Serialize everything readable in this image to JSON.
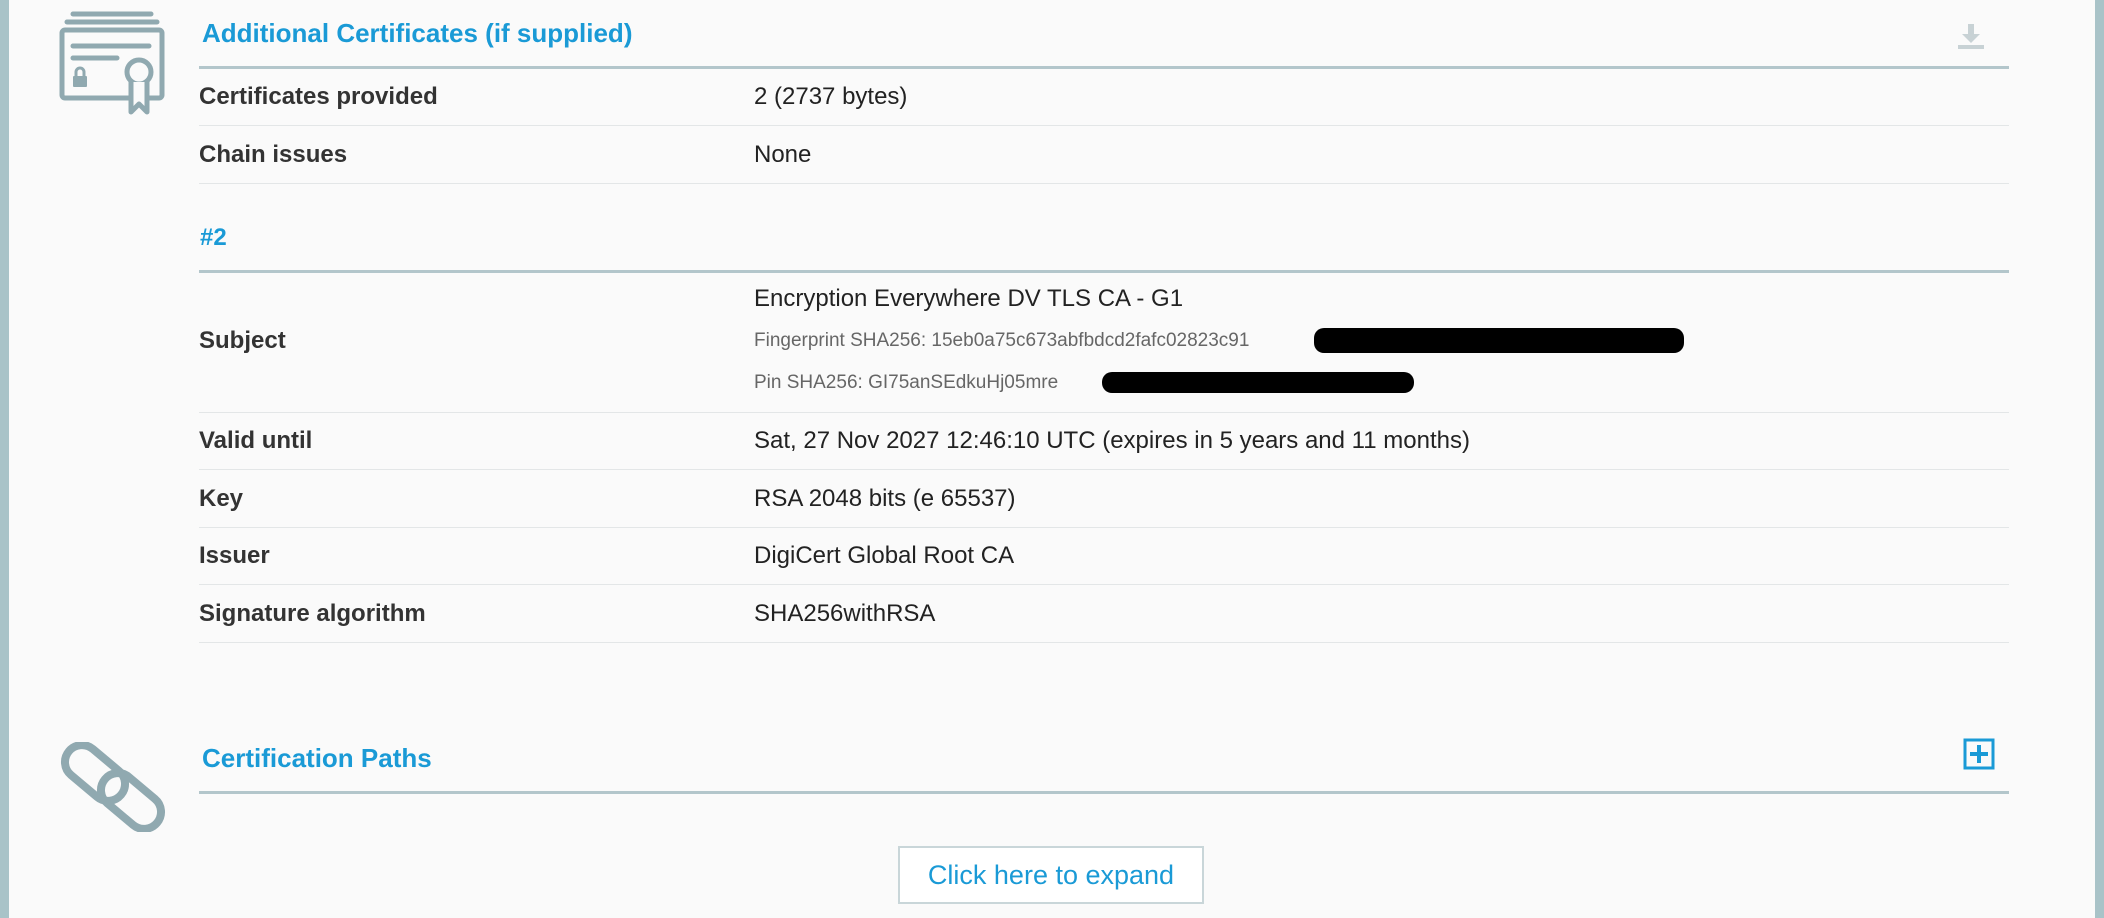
{
  "additional_certificates": {
    "title": "Additional Certificates (if supplied)",
    "rows": [
      {
        "label": "Certificates provided",
        "value": "2 (2737 bytes)"
      },
      {
        "label": "Chain issues",
        "value": "None"
      }
    ]
  },
  "cert2": {
    "heading": "#2",
    "subject": {
      "label": "Subject",
      "name": "Encryption Everywhere DV TLS CA - G1",
      "fingerprint": "Fingerprint SHA256: 15eb0a75c673abfbdcd2fafc02823c91",
      "pin": "Pin SHA256: GI75anSEdkuHj05mre"
    },
    "rows": [
      {
        "label": "Valid until",
        "value": "Sat, 27 Nov 2027 12:46:10 UTC (expires in 5 years and 11 months)"
      },
      {
        "label": "Key",
        "value": "RSA 2048 bits (e 65537)"
      },
      {
        "label": "Issuer",
        "value": "DigiCert Global Root CA"
      },
      {
        "label": "Signature algorithm",
        "value": "SHA256withRSA"
      }
    ]
  },
  "certification_paths": {
    "title": "Certification Paths",
    "expand_label": "Click here to expand"
  },
  "colors": {
    "accent": "#1a9ad6",
    "border": "#b3c6cb",
    "frame": "#a9c3c8",
    "icon": "#90a9b0"
  },
  "icons": {
    "certificate": "certificate-icon",
    "download": "download-icon",
    "link": "link-icon",
    "expand": "plus-square-icon"
  }
}
